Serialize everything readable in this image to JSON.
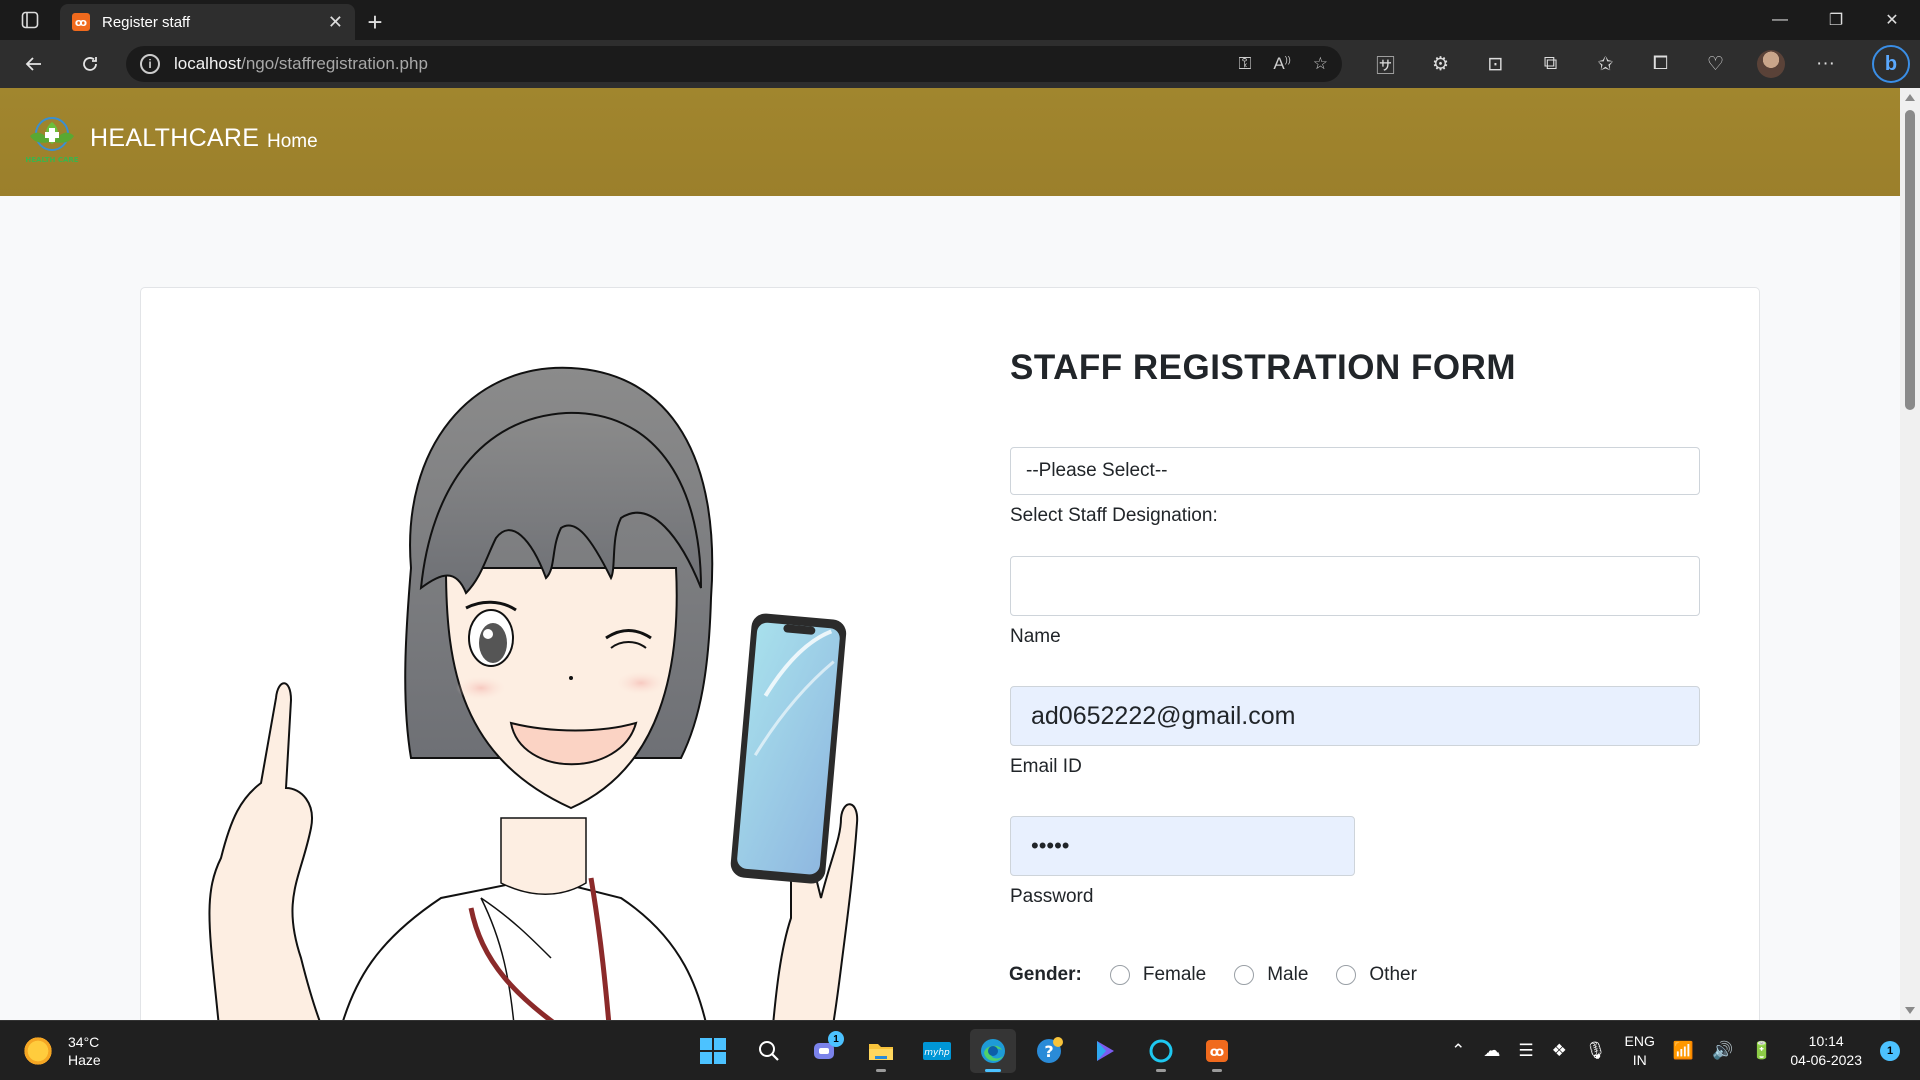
{
  "browser": {
    "tab_title": "Register staff",
    "tab_favicon": "xampp-icon",
    "url_host": "localhost",
    "url_path": "/ngo/staffregistration.php"
  },
  "site": {
    "brand": "HEALTHCARE",
    "logo_text": "HEALTH CARE",
    "nav_home": "Home",
    "accent_color": "#9e832d"
  },
  "form": {
    "title": "STAFF REGISTRATION FORM",
    "designation_select_value": "--Please Select--",
    "designation_label": "Select Staff Designation:",
    "name_value": "",
    "name_label": "Name",
    "email_value": "ad0652222@gmail.com",
    "email_label": "Email ID",
    "password_value": "•••••",
    "password_label": "Password",
    "gender_label": "Gender:",
    "gender_options": [
      "Female",
      "Male",
      "Other"
    ]
  },
  "taskbar": {
    "weather_temp": "34°C",
    "weather_condition": "Haze",
    "teams_badge": "1",
    "lang_top": "ENG",
    "lang_bottom": "IN",
    "time": "10:14",
    "date": "04-06-2023",
    "notification_count": "1"
  }
}
